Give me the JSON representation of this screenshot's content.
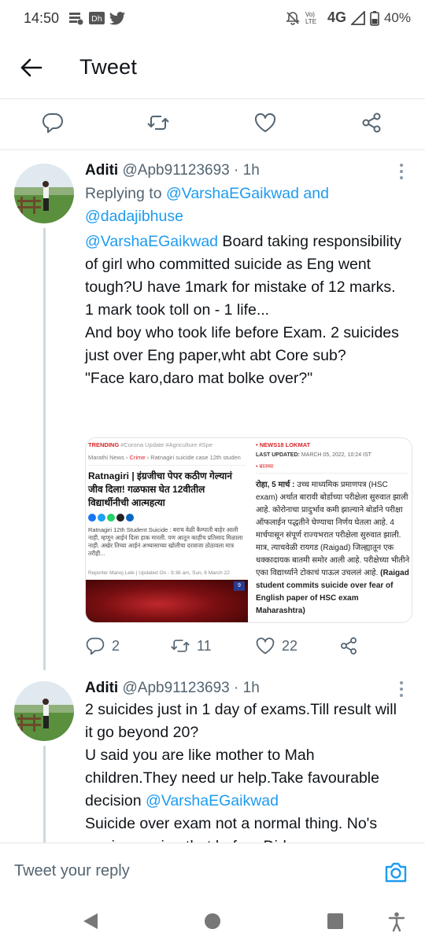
{
  "status_bar": {
    "time": "14:50",
    "network": "4G",
    "volte": "Vo) LTE",
    "battery": "40%"
  },
  "header": {
    "title": "Tweet"
  },
  "tweets": [
    {
      "name": "Aditi",
      "handle": "@Apb91123693",
      "dot": "·",
      "time": "1h",
      "replying_prefix": "Replying to ",
      "replying_user1": "@VarshaEGaikwad",
      "replying_and": " and",
      "replying_user2": "@dadajibhuse",
      "mention": "@VarshaEGaikwad",
      "text_first": " Board taking responsibility of girl who committed suicide as Eng went tough?U have 1mark for mistake of 12 marks.",
      "text_lines": [
        "1 mark took toll on - 1 life...",
        "And boy who took life before Exam. 2 suicides just over Eng paper,wht abt Core sub?",
        "\"Face karo,daro mat bolke over?\""
      ],
      "media_left": {
        "trending": "TRENDING",
        "trending_rest": "#Corona Update  #Agriculture  #Spe",
        "crumb_a": "Marathi News",
        "crumb_b": "Crime",
        "crumb_c": "Ratnagiri suicide case 12th studen",
        "headline": "Ratnagiri | इंग्रजीचा पेपर कठीण गेल्यानं जीव दिला! गळफास घेत 12वीतील विद्यार्थीनीची आत्महत्या",
        "body": "Ratnagiri 12th Student Suicide : बराच वेळी कैम्पाती बाहेर आली नाही, म्हणून आईनं दिला हाक मारली. पण आतून काहीच प्रतिसाद मिळाला नाही. अखेर तिच्या आईनं अभ्यासाच्या खोलीचा दरवाजा ठोठावला मात्र तरीही...",
        "reporter": "Reporter Manoj Lele  |  Updated On - 9:36 am, Sun, 6 March 22",
        "badge": "9"
      },
      "media_right": {
        "tag": "• NEWS18 LOKMAT",
        "updated_label": "LAST UPDATED:",
        "updated_value": " MARCH 05, 2022, 10:24 IST",
        "section": "• बातम्या",
        "body_bold": "रोहा, 5 मार्च :",
        "body": " उच्च माध्यमिक प्रमाणपत्र (HSC exam) अर्थात बारावी बोर्डाच्या परीक्षेला सुरुवात झाली आहे. कोरोनाचा प्रादुर्भाव कमी झाल्याने बोर्डाने परीक्षा ऑफलाईन पद्धतीने घेण्याचा निर्णय घेतला आहे. 4 मार्चपासून संपूर्ण राज्यभरात परीक्षेला सुरुवात झाली. मात्र, त्याचवेळी रायगड (Raigad) जिल्ह्यातून एक धक्कादायक बातमी समोर आली आहे. परीक्षेच्या भीतीने एका विद्यार्थ्याने टोकाचं पाऊल उचललं आहे.",
        "body_bold_end": " (Raigad student commits suicide over fear of English paper of HSC exam Maharashtra)"
      },
      "stats": {
        "replies": "2",
        "retweets": "11",
        "likes": "22"
      }
    },
    {
      "name": "Aditi",
      "handle": "@Apb91123693",
      "dot": "·",
      "time": "1h",
      "line1": "2 suicides just in 1 day of exams.Till result will it go beyond 20?",
      "line2_pre": "U said you are like mother to Mah children.They need ur help.Take favourable decision ",
      "line2_mention": "@VarshaEGaikwad",
      "line3": "Suicide over exam not a normal thing. No's",
      "line4": "are increasing that before Did..."
    }
  ],
  "reply_bar": {
    "placeholder": "Tweet your reply"
  },
  "colors": {
    "link": "#1d9bf0",
    "secondary_text": "#536471",
    "divider": "#e6e6e6"
  }
}
